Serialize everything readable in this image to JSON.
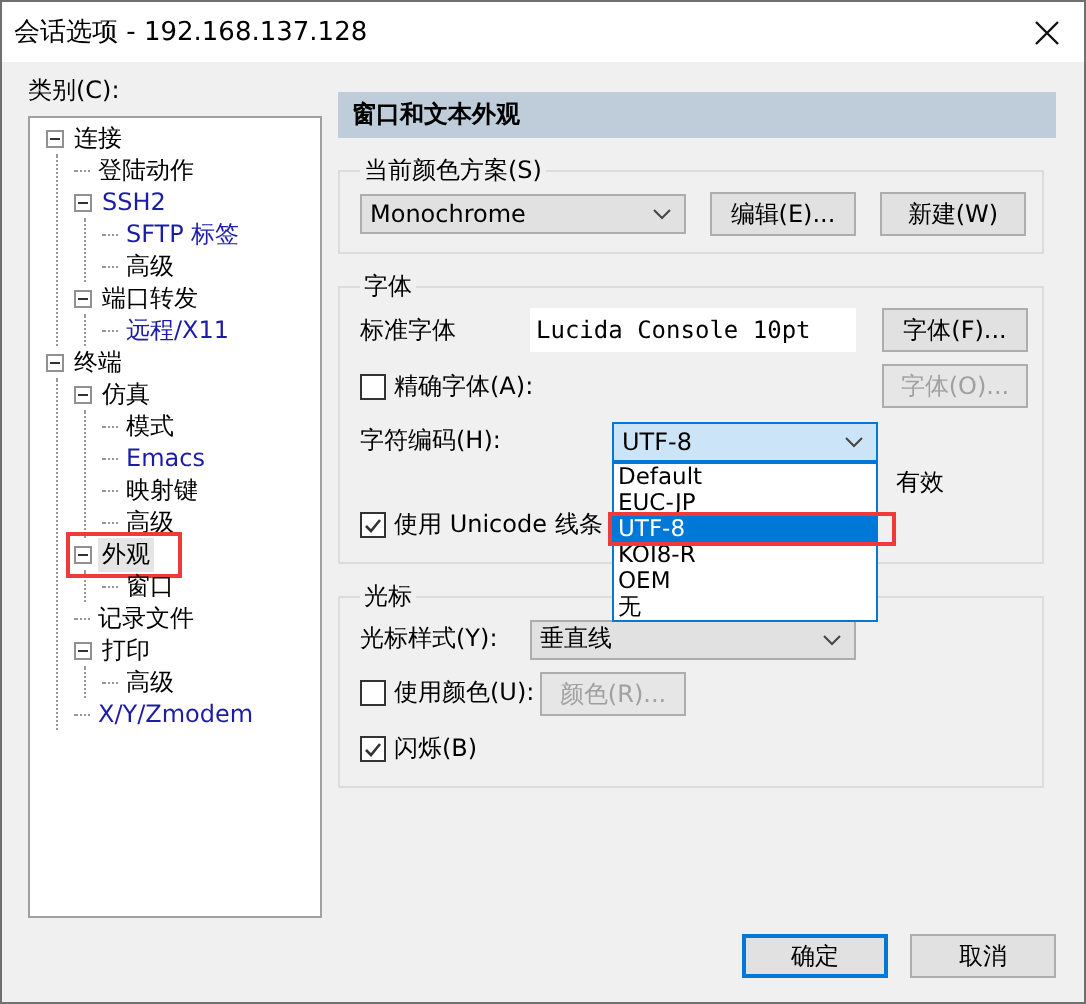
{
  "window": {
    "title": "会话选项 - 192.168.137.128"
  },
  "category_label": "类别(C):",
  "tree": [
    {
      "label": "连接",
      "color": "#000000",
      "selected": false,
      "highlighted": false,
      "expanded": true,
      "children": [
        {
          "label": "登陆动作",
          "color": "#000000",
          "selected": false,
          "highlighted": false
        },
        {
          "label": "SSH2",
          "color": "#1c1ca8",
          "selected": false,
          "highlighted": false,
          "expanded": true,
          "children": [
            {
              "label": "SFTP 标签",
              "color": "#1c1ca8",
              "selected": false,
              "highlighted": false
            },
            {
              "label": "高级",
              "color": "#000000",
              "selected": false,
              "highlighted": false
            }
          ]
        },
        {
          "label": "端口转发",
          "color": "#000000",
          "selected": false,
          "highlighted": false,
          "expanded": true,
          "children": [
            {
              "label": "远程/X11",
              "color": "#1c1ca8",
              "selected": false,
              "highlighted": false
            }
          ]
        }
      ]
    },
    {
      "label": "终端",
      "color": "#000000",
      "selected": false,
      "highlighted": false,
      "expanded": true,
      "children": [
        {
          "label": "仿真",
          "color": "#000000",
          "selected": false,
          "highlighted": false,
          "expanded": true,
          "children": [
            {
              "label": "模式",
              "color": "#000000",
              "selected": false,
              "highlighted": false
            },
            {
              "label": "Emacs",
              "color": "#1c1ca8",
              "selected": false,
              "highlighted": false
            },
            {
              "label": "映射键",
              "color": "#000000",
              "selected": false,
              "highlighted": false
            },
            {
              "label": "高级",
              "color": "#000000",
              "selected": false,
              "highlighted": false
            }
          ]
        },
        {
          "label": "外观",
          "color": "#000000",
          "selected": true,
          "highlighted": true,
          "expanded": true,
          "children": [
            {
              "label": "窗口",
              "color": "#000000",
              "selected": false,
              "highlighted": false
            }
          ]
        },
        {
          "label": "记录文件",
          "color": "#000000",
          "selected": false,
          "highlighted": false
        },
        {
          "label": "打印",
          "color": "#000000",
          "selected": false,
          "highlighted": false,
          "expanded": true,
          "children": [
            {
              "label": "高级",
              "color": "#000000",
              "selected": false,
              "highlighted": false
            }
          ]
        },
        {
          "label": "X/Y/Zmodem",
          "color": "#1c1ca8",
          "selected": false,
          "highlighted": false
        }
      ]
    }
  ],
  "panel": {
    "header": "窗口和文本外观",
    "color_scheme": {
      "legend": "当前颜色方案(S)",
      "value": "Monochrome",
      "buttons": [
        "编辑(E)...",
        "新建(W)"
      ]
    },
    "font": {
      "legend": "字体",
      "standard_label": "标准字体",
      "preview": "Lucida Console 10pt",
      "font_button": {
        "label": "字体(F)...",
        "disabled": false
      },
      "precise": {
        "label": "精确字体(A):",
        "checked": false
      },
      "precise_button": {
        "label": "字体(O)...",
        "disabled": true
      },
      "encoding_label": "字符编码(H):",
      "encoding_value": "UTF-8",
      "encoding_open": true,
      "encoding_options": [
        {
          "label": "Default",
          "selected": false,
          "highlighted": false
        },
        {
          "label": "EUC-JP",
          "selected": false,
          "highlighted": false
        },
        {
          "label": "UTF-8",
          "selected": true,
          "highlighted": true
        },
        {
          "label": "KOI8-R",
          "selected": false,
          "highlighted": false
        },
        {
          "label": "OEM",
          "selected": false,
          "highlighted": false
        },
        {
          "label": "无",
          "selected": false,
          "highlighted": false
        }
      ],
      "hidden_row_text": "有效",
      "unicode": {
        "label": "使用 Unicode 线条",
        "checked": true
      }
    },
    "cursor": {
      "legend": "光标",
      "style_label": "光标样式(Y):",
      "style_value": "垂直线",
      "use_color": {
        "label": "使用颜色(U):",
        "checked": false
      },
      "color_button": {
        "label": "颜色(R)...",
        "disabled": true
      },
      "blink": {
        "label": "闪烁(B)",
        "checked": true
      }
    }
  },
  "buttons": [
    {
      "label": "确定",
      "default": true
    },
    {
      "label": "取消",
      "default": false
    }
  ]
}
